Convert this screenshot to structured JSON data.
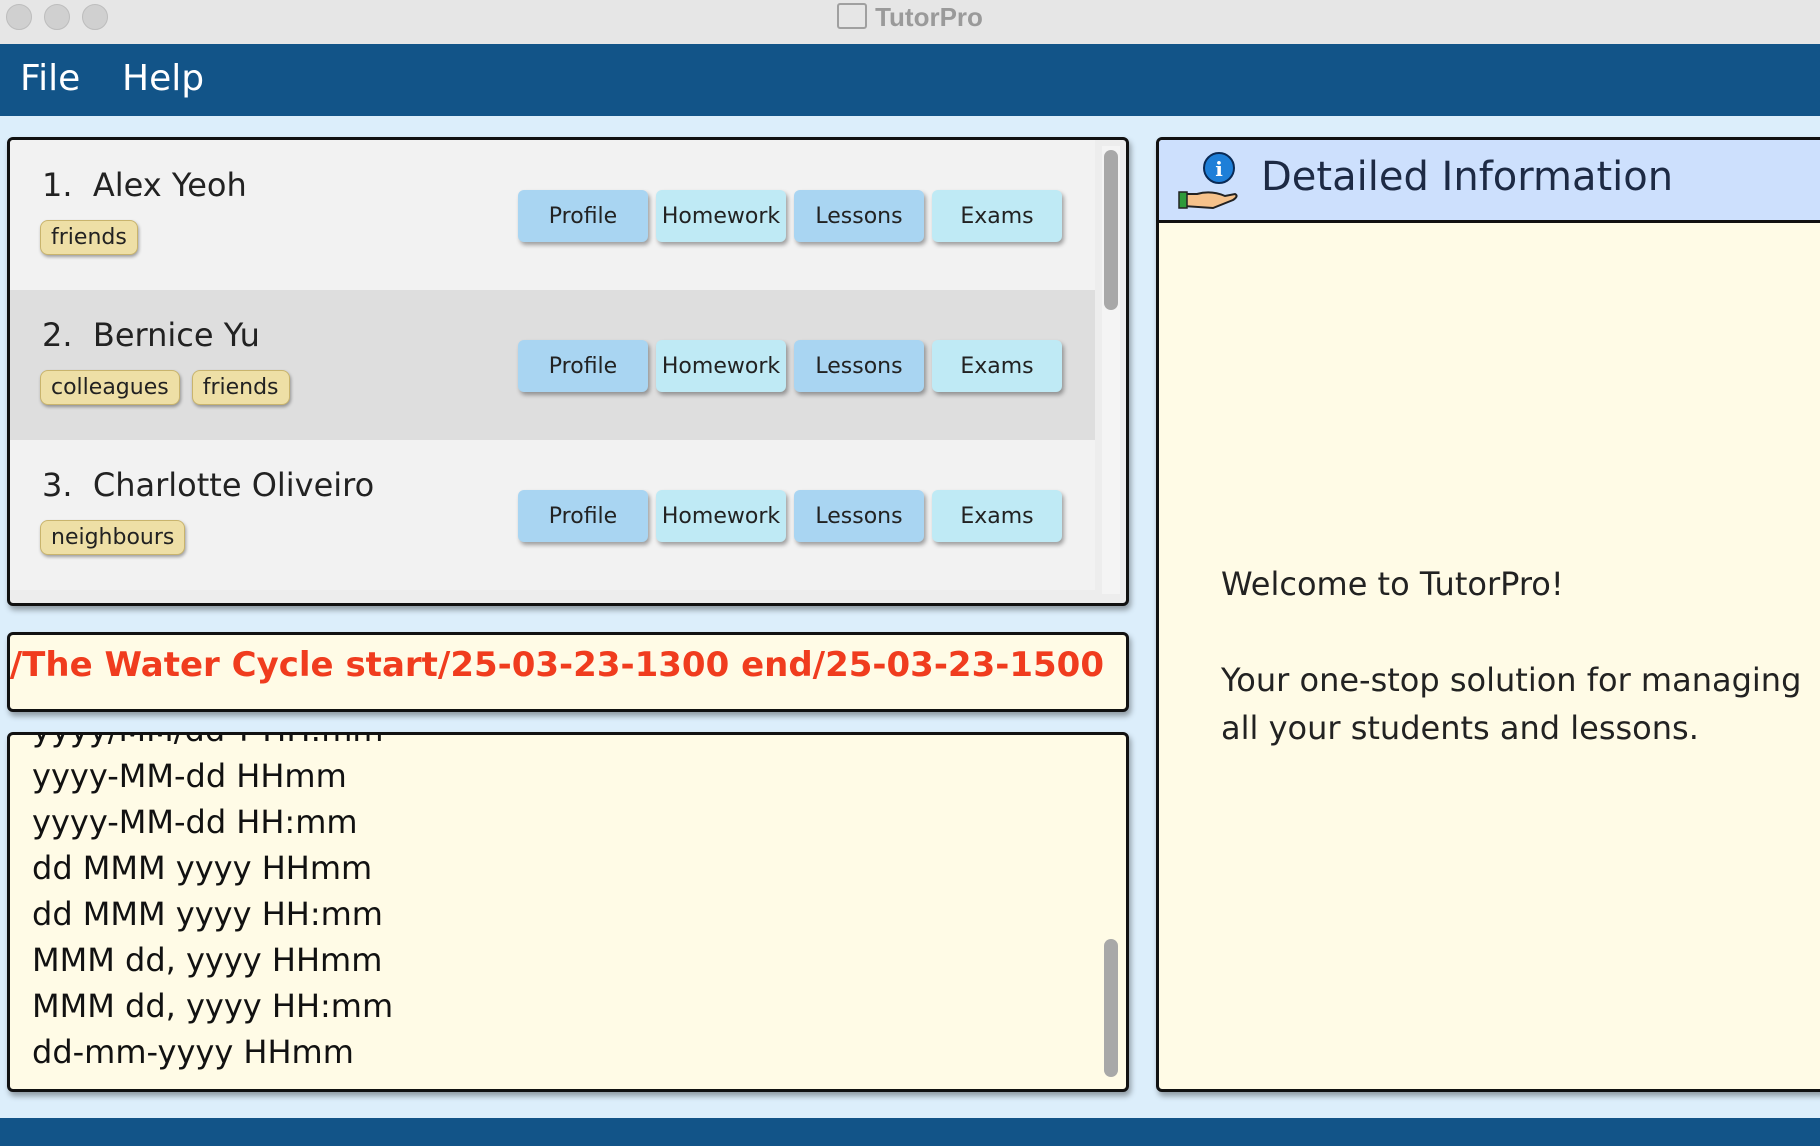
{
  "window": {
    "title": "TutorPro"
  },
  "menu": {
    "items": [
      "File",
      "Help"
    ]
  },
  "students": [
    {
      "index": "1.",
      "name": "Alex Yeoh",
      "tags": [
        "friends"
      ]
    },
    {
      "index": "2.",
      "name": "Bernice Yu",
      "tags": [
        "colleagues",
        "friends"
      ]
    },
    {
      "index": "3.",
      "name": "Charlotte Oliveiro",
      "tags": [
        "neighbours"
      ]
    }
  ],
  "row_buttons": [
    "Profile",
    "Homework",
    "Lessons",
    "Exams"
  ],
  "command": {
    "text": "/The Water Cycle start/25-03-23-1300 end/25-03-23-1500"
  },
  "result": {
    "lines": [
      "yyyy/MM/dd'T'HH:mm",
      "yyyy-MM-dd HHmm",
      "yyyy-MM-dd HH:mm",
      "dd MMM yyyy HHmm",
      "dd MMM yyyy HH:mm",
      "MMM dd, yyyy HHmm",
      "MMM dd, yyyy HH:mm",
      "dd-mm-yyyy HHmm"
    ]
  },
  "detail": {
    "title": "Detailed Information",
    "welcome": "Welcome to TutorPro!",
    "tagline": "Your one-stop solution for managing all your students and lessons."
  },
  "colors": {
    "menubar": "#125488",
    "command_text": "#f03c1e",
    "tag_bg": "#eedfa6",
    "detail_header": "#cde0fd"
  },
  "icons": {
    "detail_header": "info-hand-icon",
    "window": "app-icon"
  }
}
